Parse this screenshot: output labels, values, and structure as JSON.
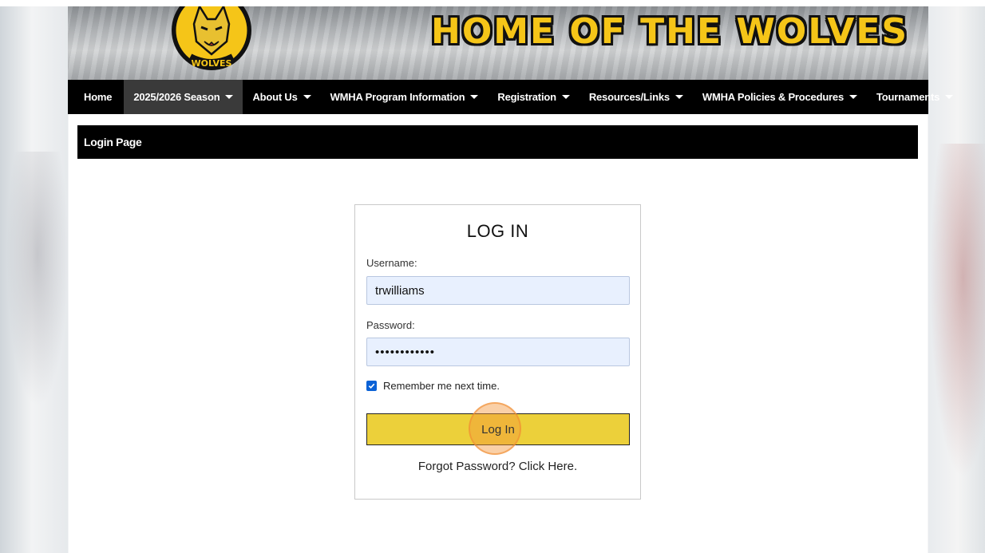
{
  "banner": {
    "title": "HOME OF THE WOLVES",
    "logo_text": "WOLVES"
  },
  "nav": {
    "items": [
      {
        "label": "Home",
        "dropdown": false
      },
      {
        "label": "2025/2026 Season",
        "dropdown": true,
        "active": true
      },
      {
        "label": "About Us",
        "dropdown": true
      },
      {
        "label": "WMHA Program Information",
        "dropdown": true
      },
      {
        "label": "Registration",
        "dropdown": true
      },
      {
        "label": "Resources/Links",
        "dropdown": true
      },
      {
        "label": "WMHA Policies & Procedures",
        "dropdown": true
      },
      {
        "label": "Tournaments",
        "dropdown": true
      }
    ]
  },
  "page": {
    "title": "Login Page"
  },
  "login": {
    "heading": "LOG IN",
    "username_label": "Username:",
    "username_value": "trwilliams",
    "password_label": "Password:",
    "password_value": "••••••••••••",
    "remember_label": "Remember me next time.",
    "remember_checked": true,
    "submit_label": "Log In",
    "forgot_label": "Forgot Password? Click Here."
  },
  "colors": {
    "accent_yellow": "#ecd03a",
    "nav_bg": "#000000",
    "title_yellow": "#f5c518",
    "checkbox_blue": "#0b62d6"
  }
}
